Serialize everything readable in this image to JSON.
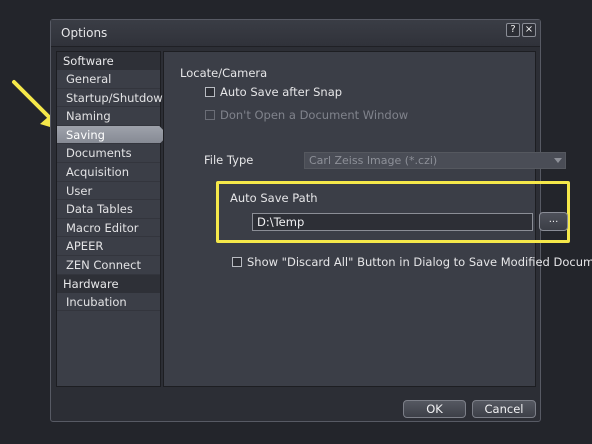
{
  "window": {
    "title": "Options",
    "help_label": "?",
    "close_label": "×"
  },
  "sidebar": {
    "categories": [
      {
        "label": "Software",
        "items": [
          "General",
          "Startup/Shutdown",
          "Naming",
          "Saving",
          "Documents",
          "Acquisition",
          "User",
          "Data Tables",
          "Macro Editor",
          "APEER",
          "ZEN Connect"
        ]
      },
      {
        "label": "Hardware",
        "items": [
          "Incubation"
        ]
      }
    ],
    "selected": "Saving"
  },
  "content": {
    "locate_camera": {
      "heading": "Locate/Camera",
      "auto_save_after_snap": "Auto Save after Snap",
      "dont_open_document_window": "Don't Open a Document Window",
      "file_type_label": "File Type",
      "file_type_value": "Carl Zeiss Image (*.czi)"
    },
    "auto_save_path": {
      "heading": "Auto Save Path",
      "value": "D:\\Temp",
      "browse_label": "..."
    },
    "show_discard_all": "Show \"Discard All\" Button in Dialog to Save Modified Documents"
  },
  "footer": {
    "ok_label": "OK",
    "cancel_label": "Cancel"
  },
  "colors": {
    "highlight": "#f5e84a",
    "arrow": "#f5e84a",
    "selected_item": "#9ea2ab"
  }
}
